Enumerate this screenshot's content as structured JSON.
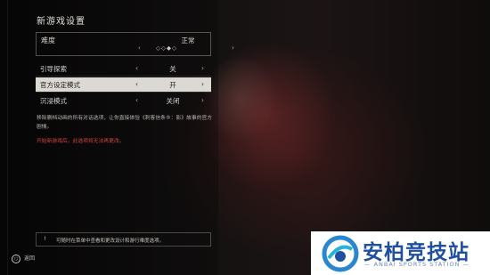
{
  "header": {
    "title": "新游戏设置"
  },
  "difficulty": {
    "label": "难度",
    "value": "正常",
    "pips": "◇◇◆◇",
    "left_arrow": "‹",
    "right_arrow": "›"
  },
  "options": [
    {
      "label": "引导探索",
      "value": "关",
      "selected": false
    },
    {
      "label": "官方设定模式",
      "value": "开",
      "selected": true
    },
    {
      "label": "沉浸模式",
      "value": "关闭",
      "selected": false
    }
  ],
  "arrows": {
    "left": "‹",
    "right": "›"
  },
  "description": "移除删档动画的所有对话选项，让你直接体验《刺客信条®：影》故事的官方剧情。",
  "warning": "开始新游戏后，此选项将无法再更改。",
  "tip": {
    "icon": "!",
    "text": "可随时在菜单中查看和更改设计和游行难度选项。"
  },
  "footer": {
    "back_icon": "○",
    "back_label": "返回"
  },
  "watermark": {
    "cn": "安柏竞技站",
    "en": "— ANBAI SPORTS STATION —"
  },
  "colors": {
    "accent_selected": "#dcd9d4",
    "warning": "#d2453d",
    "logo_blue": "#1f4fa0"
  }
}
